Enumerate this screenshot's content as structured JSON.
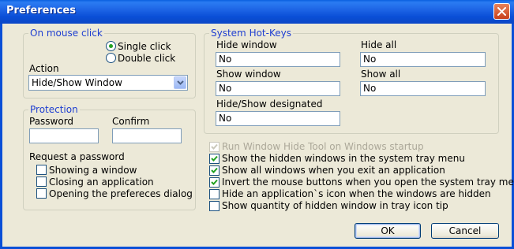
{
  "window": {
    "title": "Preferences"
  },
  "mouse_click": {
    "group_title": "On mouse click",
    "single_click_label": "Single click",
    "double_click_label": "Double click",
    "selected": "single",
    "action_label": "Action",
    "action_value": "Hide/Show Window"
  },
  "protection": {
    "group_title": "Protection",
    "password_label": "Password",
    "confirm_label": "Confirm",
    "password_value": "",
    "confirm_value": "",
    "request_label": "Request a password",
    "options": [
      {
        "label": "Showing a window",
        "checked": false
      },
      {
        "label": "Closing an application",
        "checked": false
      },
      {
        "label": "Opening the prefereces dialog",
        "checked": false
      }
    ]
  },
  "hotkeys": {
    "group_title": "System Hot-Keys",
    "hide_window_label": "Hide window",
    "hide_window_value": "No",
    "hide_all_label": "Hide all",
    "hide_all_value": "No",
    "show_window_label": "Show window",
    "show_window_value": "No",
    "show_all_label": "Show all",
    "show_all_value": "No",
    "hide_show_designated_label": "Hide/Show designated",
    "hide_show_designated_value": "No"
  },
  "options": [
    {
      "label": "Run Window Hide Tool on Windows startup",
      "checked": true,
      "disabled": true
    },
    {
      "label": "Show the hidden windows in the system tray menu",
      "checked": true,
      "disabled": false
    },
    {
      "label": "Show all windows when you exit an application",
      "checked": true,
      "disabled": false
    },
    {
      "label": "Invert the mouse buttons when you open the system tray menu",
      "checked": true,
      "disabled": false
    },
    {
      "label": "Hide an application`s icon when the windows are hidden",
      "checked": false,
      "disabled": false
    },
    {
      "label": "Show quantity of hidden window in tray icon tip",
      "checked": false,
      "disabled": false
    }
  ],
  "buttons": {
    "ok": "OK",
    "cancel": "Cancel"
  },
  "colors": {
    "title_bar": "#0a4fd7",
    "group_title": "#1f3fd1",
    "check_mark": "#21a121",
    "dialog_bg": "#ece9d8"
  }
}
